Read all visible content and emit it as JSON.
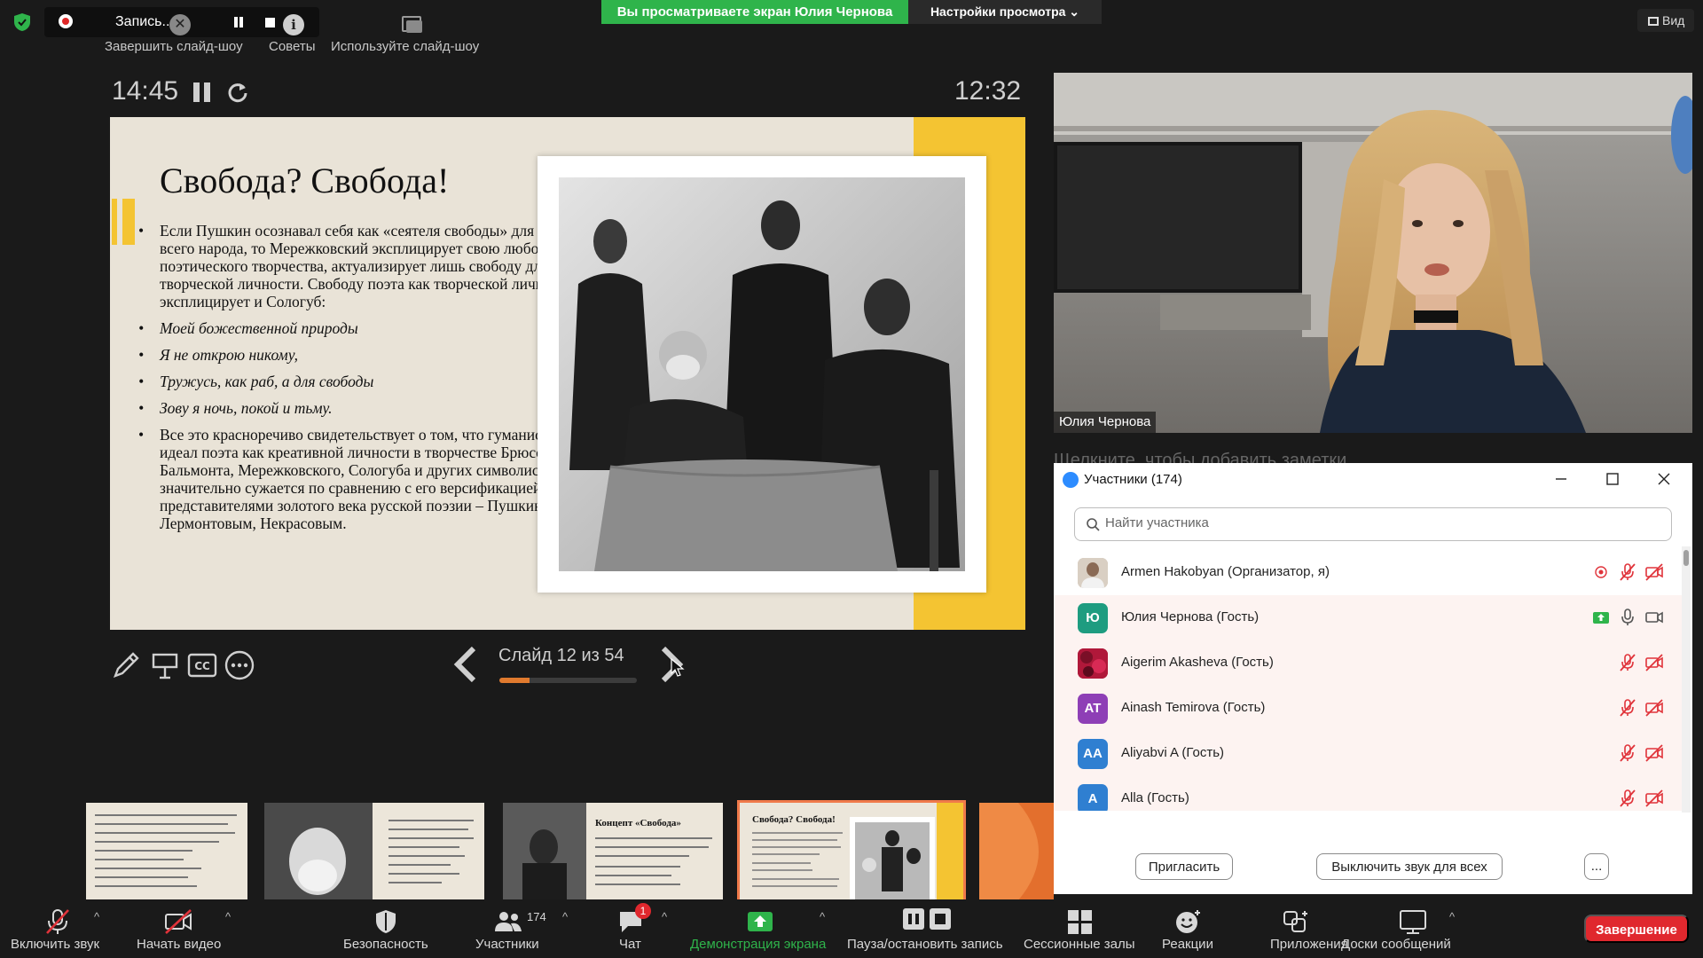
{
  "recording": {
    "label": "Запись...",
    "close_glyph": "✕",
    "info_glyph": "i"
  },
  "powerpoint_menu": {
    "end_slideshow": "Завершить слайд-шоу",
    "tips": "Советы",
    "use_slideshow": "Используйте слайд-шоу"
  },
  "share_banner": "Вы просматриваете экран Юлия Чернова",
  "view_settings": "Настройки просмотра ⌄",
  "view_button": "Вид",
  "presenter": {
    "elapsed": "14:45",
    "clock": "12:32",
    "slide_counter": "Слайд 12 из 54",
    "current_slide": 12,
    "total_slides": 54
  },
  "slide": {
    "title": "Свобода? Свобода!",
    "bullets": [
      {
        "text": "Если Пушкин осознавал себя как «сеятеля свободы» для общества, для всего народа, то Мережковский эксплицирует свою любовь к свободе поэтического творчества, актуализирует лишь свободу для поэта как творческой личности. Свободу поэта как творческой личности эксплицирует и Сологуб:",
        "italic": false
      },
      {
        "text": "Моей божественной природы",
        "italic": true
      },
      {
        "text": "Я не открою никому,",
        "italic": true
      },
      {
        "text": "Тружусь, как раб, а для свободы",
        "italic": true
      },
      {
        "text": "Зову я ночь, покой и тьму.",
        "italic": true
      },
      {
        "text": "Все это красноречиво свидетельствует о том, что гуманистический идеал поэта как креативной личности в творчестве Брюсова, Бальмонта, Мережковского, Сологуба и других символистов значительно сужается по сравнению с его версификацией представителями золотого века русской поэзии – Пушкиным, Лермонтовым, Некрасовым.",
        "italic": false
      }
    ]
  },
  "thumbnails": [
    {
      "title": ""
    },
    {
      "title": ""
    },
    {
      "title": "Концепт «Свобода»"
    },
    {
      "title": "Свобода? Свобода!"
    },
    {
      "title": ""
    }
  ],
  "video": {
    "name": "Юлия Чернова"
  },
  "notes_hint": "Щелкните, чтобы добавить заметки",
  "participants": {
    "title": "Участники (174)",
    "search_placeholder": "Найти участника",
    "list": [
      {
        "name": "Armen Hakobyan (Организатор, я)",
        "initials": "",
        "avatar_color": "#c9b7a4",
        "recording": true,
        "sharing": false,
        "muted": true,
        "video_off": true
      },
      {
        "name": "Юлия Чернова (Гость)",
        "initials": "Ю",
        "avatar_color": "#1e9c80",
        "recording": false,
        "sharing": true,
        "muted": false,
        "video_off": false
      },
      {
        "name": "Aigerim Akasheva (Гость)",
        "initials": "",
        "avatar_color": "#b0183a",
        "recording": false,
        "sharing": false,
        "muted": true,
        "video_off": true
      },
      {
        "name": "Ainash Temirova (Гость)",
        "initials": "AT",
        "avatar_color": "#8e3fb6",
        "recording": false,
        "sharing": false,
        "muted": true,
        "video_off": true
      },
      {
        "name": "Aliyabvi A (Гость)",
        "initials": "AA",
        "avatar_color": "#2f7fd1",
        "recording": false,
        "sharing": false,
        "muted": true,
        "video_off": true
      },
      {
        "name": "Alla (Гость)",
        "initials": "A",
        "avatar_color": "#2f7fd1",
        "recording": false,
        "sharing": false,
        "muted": true,
        "video_off": true
      }
    ],
    "invite": "Пригласить",
    "mute_all": "Выключить звук для всех",
    "more": "..."
  },
  "toolbar": {
    "unmute": "Включить звук",
    "start_video": "Начать видео",
    "security": "Безопасность",
    "participants": "Участники",
    "participants_count": "174",
    "chat": "Чат",
    "chat_badge": "1",
    "share_screen": "Демонстрация экрана",
    "pause_record": "Пауза/остановить запись",
    "breakout": "Сессионные залы",
    "reactions": "Реакции",
    "apps": "Приложения",
    "whiteboards": "Доски сообщений",
    "end": "Завершение",
    "caret": "^"
  },
  "colors": {
    "share_green": "#2fb44b",
    "slide_yellow": "#f4c432",
    "progress_orange": "#e07a2e",
    "end_red": "#e0282e",
    "mute_red": "#e0333a"
  }
}
